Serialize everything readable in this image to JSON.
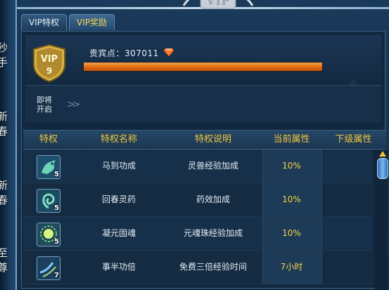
{
  "side_panel": {
    "fragments": [
      "秒手",
      "新春",
      "新春",
      "至尊"
    ]
  },
  "tabs": [
    {
      "label": "VIP特权",
      "active": false
    },
    {
      "label": "VIP奖励",
      "active": true
    }
  ],
  "crest": {
    "text": "VIP"
  },
  "vip": {
    "badge_text": "VIP",
    "level": "9",
    "points_label": "贵宾点：307011",
    "progress": 1.0
  },
  "unlock": {
    "label": "即将开启"
  },
  "table": {
    "headers": [
      "特权",
      "特权名称",
      "特权说明",
      "当前属性",
      "下级属性"
    ],
    "rows": [
      {
        "icon": "horse-icon",
        "icon_level": "5",
        "name": "马到功成",
        "desc": "灵兽经验加成",
        "current": "10%",
        "next": ""
      },
      {
        "icon": "herb-icon",
        "icon_level": "5",
        "name": "回春灵药",
        "desc": "药效加成",
        "current": "10%",
        "next": ""
      },
      {
        "icon": "soul-orb-icon",
        "icon_level": "5",
        "name": "凝元固魂",
        "desc": "元魂珠经验加成",
        "current": "10%",
        "next": ""
      },
      {
        "icon": "wind-icon",
        "icon_level": "7",
        "name": "事半功倍",
        "desc": "免费三倍经验时间",
        "current": "7小时",
        "next": ""
      }
    ]
  },
  "colors": {
    "accent_gold": "#f0c53a",
    "progress_orange": "#e06b12",
    "panel_blue": "#12283f"
  }
}
